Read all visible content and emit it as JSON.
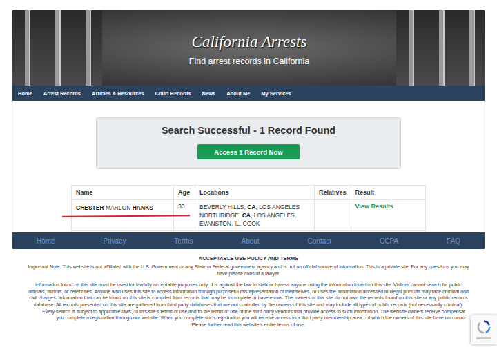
{
  "header": {
    "title": "California Arrests",
    "subtitle": "Find arrest records in California"
  },
  "nav": [
    "Home",
    "Arrest Records",
    "Articles & Resources",
    "Court Records",
    "News",
    "About Me",
    "My Services"
  ],
  "search_result": {
    "title": "Search Successful - 1 Record Found",
    "button": "Access 1 Record Now"
  },
  "table": {
    "columns": [
      "Name",
      "Age",
      "Locations",
      "Relatives",
      "Result"
    ],
    "rows": [
      {
        "name": [
          {
            "text": "CHESTER ",
            "bold": true
          },
          {
            "text": "MARLON ",
            "bold": false
          },
          {
            "text": "HANKS",
            "bold": true
          }
        ],
        "age": "30",
        "locations": [
          [
            {
              "text": "BEVERLY HILLS, ",
              "bold": false
            },
            {
              "text": "CA",
              "bold": true
            },
            {
              "text": ", LOS ANGELES",
              "bold": false
            }
          ],
          [
            {
              "text": "NORTHRIDGE, ",
              "bold": false
            },
            {
              "text": "CA",
              "bold": true
            },
            {
              "text": ", LOS ANGELES",
              "bold": false
            }
          ],
          [
            {
              "text": "EVANSTON, IL, COOK",
              "bold": false
            }
          ]
        ],
        "result": "View Results"
      }
    ]
  },
  "footer_nav": [
    "Home",
    "Privacy",
    "Terms",
    "About",
    "Contact",
    "CCPA",
    "FAQ"
  ],
  "terms": {
    "title": "ACCEPTABLE USE POLICY AND TERMS",
    "note_lines": [
      "Important Note: This website is not affiliated with the U.S. Government or any State or Federal government agency and is not an official source of information. This is a private site. For any questions you may",
      "have please consult a lawyer."
    ],
    "body_lines": [
      {
        "text": "Information found on this site must be used for lawfully acceptable purposes only. It is against the law to stalk or harass anyone using the information found on this site. Visitors cannot search for public",
        "cut": false
      },
      {
        "text": "officials, minors, or celebrities. Anyone who uses this site to access information through purposeful misrepresentation of themselves, or uses the information accessed in illegal pursuits may face criminal and",
        "cut": false
      },
      {
        "text": "civil charges. Information that can be found on this site is compiled from records that may be incomplete or have errors. The owners of this site do not own the records found on this site or any public records",
        "cut": false
      },
      {
        "text": "database. All records presented on this site are gathered from third party databases that are not controlled by the owners of this site and may include all types of public records (not necessarily criminal).",
        "cut": false
      },
      {
        "text": "Every search is subject to applicable laws, to this site's terms of use and to the terms of use of the third party vendors that provide access to such information. The website owners receive compensat",
        "cut": true
      },
      {
        "text": "you complete a registration through our website. When you complete such registration you will receive access to a third party membership area - of which the owners of this site have no contro",
        "cut": true
      },
      {
        "text": "Please further read this website's entire terms of use.",
        "cut": false
      }
    ]
  }
}
